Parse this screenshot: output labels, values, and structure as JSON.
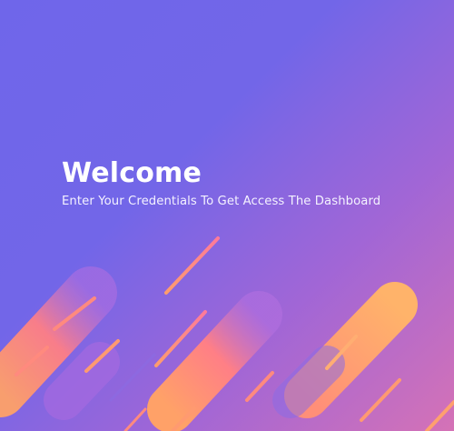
{
  "hero": {
    "title": "Welcome",
    "subtitle": "Enter Your Credentials To Get Access The Dashboard"
  },
  "colors": {
    "bg_start": "#6f66ea",
    "bg_end": "#d572b6",
    "stripe_light": "#ffb06b",
    "stripe_pink": "#ff6f8f",
    "stripe_violet": "#8f6ae6"
  }
}
